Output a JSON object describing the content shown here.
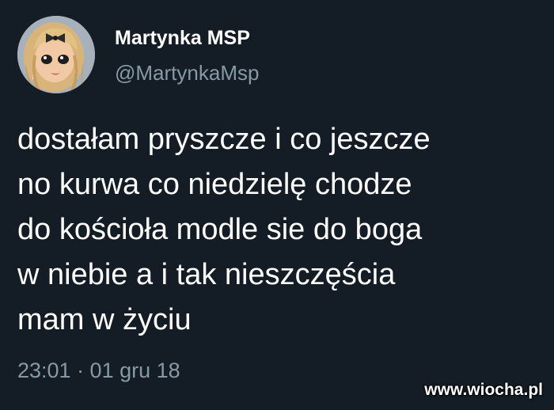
{
  "tweet": {
    "display_name": "Martynka MSP",
    "handle": "@MartynkaMsp",
    "text_lines": [
      "dostałam pryszcze i co jeszcze",
      "no kurwa co niedzielę chodze",
      "do kościoła modle sie do boga",
      "w niebie a i tak nieszczęścia",
      "mam w życiu"
    ],
    "timestamp": "23:01 · 01 gru 18"
  },
  "watermark": "www.wiocha.pl",
  "colors": {
    "background": "#141d26",
    "primary_text": "#ffffff",
    "secondary_text": "#8899a6"
  },
  "icons": {
    "avatar": "cartoon-girl-avatar"
  }
}
